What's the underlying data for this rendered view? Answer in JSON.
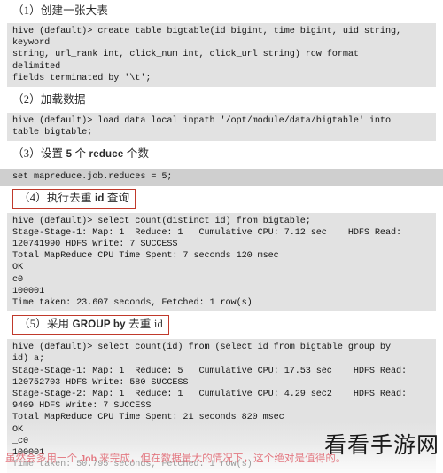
{
  "document": {
    "type": "hive-tutorial-screenshot",
    "language": "zh-CN"
  },
  "sections": [
    {
      "id": "s1",
      "heading": "（1）创建一张大表",
      "heading_boxed": false,
      "code": "hive (default)> create table bigtable(id bigint, time bigint, uid string,\nkeyword\nstring, url_rank int, click_num int, click_url string) row format\ndelimited\nfields terminated by '\\t';"
    },
    {
      "id": "s2",
      "heading": "（2）加载数据",
      "heading_boxed": false,
      "code": "hive (default)> load data local inpath '/opt/module/data/bigtable' into\ntable bigtable;"
    },
    {
      "id": "s3",
      "heading_prefix": "（3）设置 ",
      "heading_num": "5",
      "heading_mid": " 个 ",
      "heading_kw": "reduce",
      "heading_suffix": " 个数",
      "heading": "（3）设置 5 个 reduce 个数",
      "heading_boxed": false,
      "code": "set mapreduce.job.reduces = 5;"
    },
    {
      "id": "s4",
      "heading_prefix": "（4）执行去重 ",
      "heading_kw": "id",
      "heading_suffix": " 查询",
      "heading": "（4）执行去重 id 查询",
      "heading_boxed": true,
      "code": "hive (default)> select count(distinct id) from bigtable;\nStage-Stage-1: Map: 1  Reduce: 1   Cumulative CPU: 7.12 sec    HDFS Read:\n120741990 HDFS Write: 7 SUCCESS\nTotal MapReduce CPU Time Spent: 7 seconds 120 msec\nOK\nc0\n100001\nTime taken: 23.607 seconds, Fetched: 1 row(s)"
    },
    {
      "id": "s5",
      "heading_prefix": "（5）采用 ",
      "heading_kw": "GROUP by",
      "heading_suffix": " 去重 id",
      "heading": "（5）采用 GROUP by 去重 id",
      "heading_boxed": true,
      "code": "hive (default)> select count(id) from (select id from bigtable group by\nid) a;\nStage-Stage-1: Map: 1  Reduce: 5   Cumulative CPU: 17.53 sec    HDFS Read:\n120752703 HDFS Write: 580 SUCCESS\nStage-Stage-2: Map: 1  Reduce: 1   Cumulative CPU: 4.29 sec2    HDFS Read:\n9409 HDFS Write: 7 SUCCESS\nTotal MapReduce CPU Time Spent: 21 seconds 820 msec\nOK\n_c0\n100001",
      "code_faded_line": "Time taken: 50.795 seconds, Fetched: 1 row(s)"
    }
  ],
  "footer_note": {
    "before": "虽然会多用一个 ",
    "keyword": "Job",
    "after": " 来完成，但在数据量大的情况下，这个绝对是值得的。",
    "full": "虽然会多用一个 Job 来完成，但在数据量大的情况下，这个绝对是值得的。",
    "color": "#e05f6a"
  },
  "watermark": {
    "text": "看看手游网"
  },
  "colors": {
    "page_background": "#ffffff",
    "code_background": "#e2e2e2",
    "code_background_dark": "#cfcfcf",
    "code_text": "#161616",
    "heading_text": "#2b2b2b",
    "box_border": "#c0392b",
    "note_text": "#e05f6a",
    "spellcheck_underline": "#d86a7a"
  }
}
